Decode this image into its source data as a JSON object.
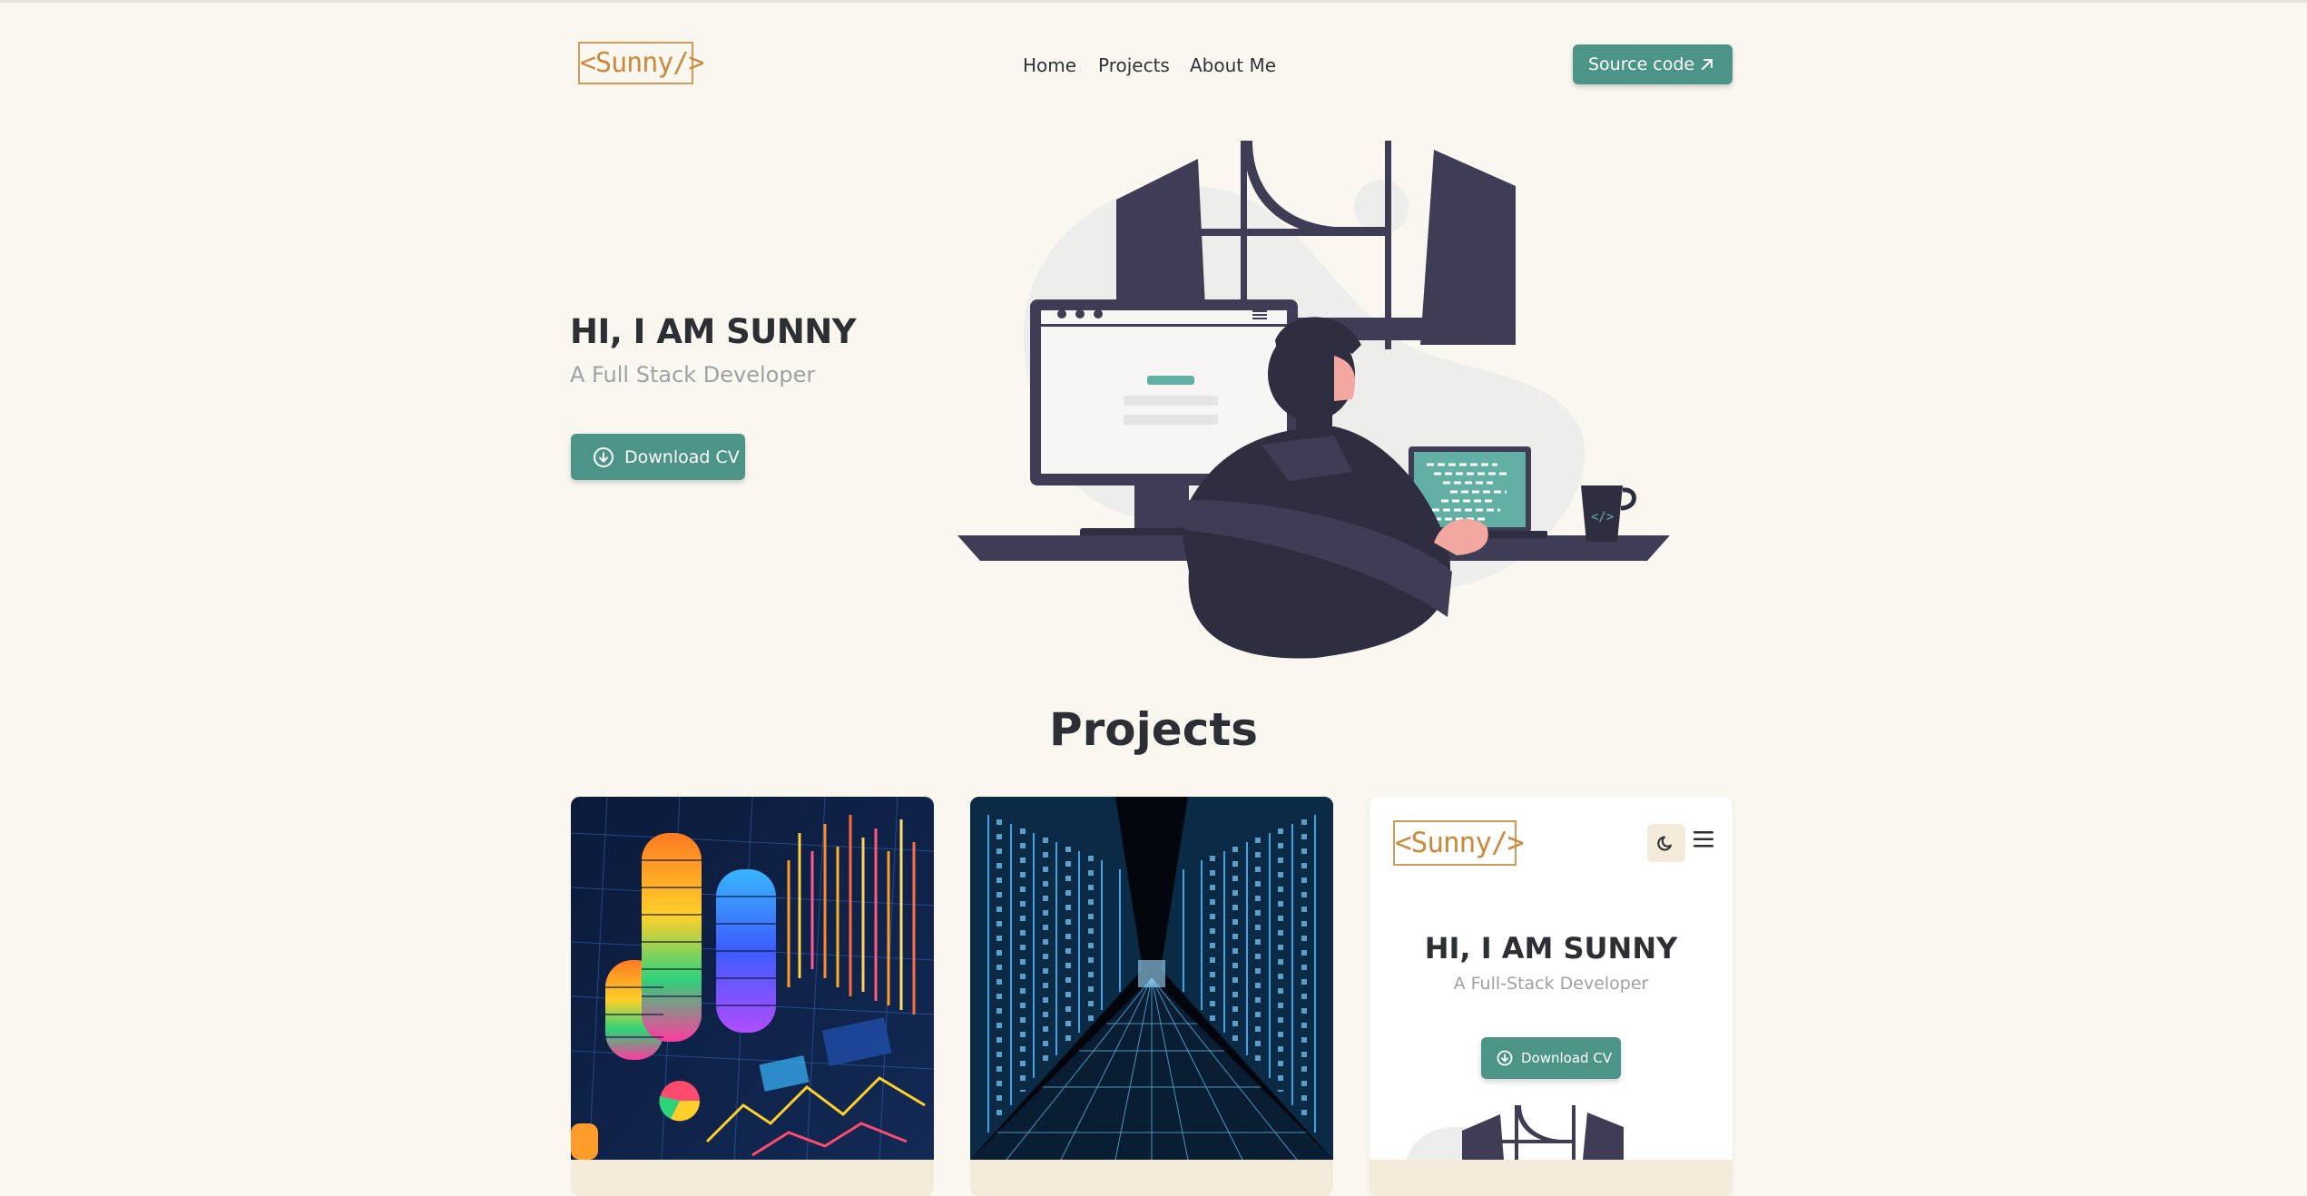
{
  "header": {
    "logo": "<Sunny/>",
    "nav": [
      "Home",
      "Projects",
      "About Me"
    ],
    "source_button": "Source code"
  },
  "hero": {
    "title": "HI, I AM SUNNY",
    "subtitle": "A Full Stack Developer",
    "cv_button": "Download CV"
  },
  "projects": {
    "title": "Projects",
    "preview": {
      "logo": "<Sunny/>",
      "title": "HI, I AM SUNNY",
      "subtitle": "A Full-Stack Developer",
      "cv_button": "Download CV"
    }
  },
  "colors": {
    "accent": "#4c9388",
    "logo": "#c98a3d",
    "background": "#faf7f1",
    "illustration": "#3f3d56"
  },
  "icons": [
    "arrow-up-right-icon",
    "download-circle-icon",
    "moon-icon",
    "hamburger-menu-icon"
  ]
}
